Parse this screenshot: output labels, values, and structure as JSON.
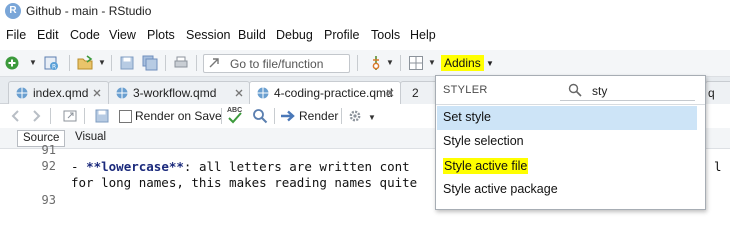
{
  "window": {
    "logo": "R",
    "title": "Github - main - RStudio"
  },
  "menu": [
    "File",
    "Edit",
    "Code",
    "View",
    "Plots",
    "Session",
    "Build",
    "Debug",
    "Profile",
    "Tools",
    "Help"
  ],
  "toolbar": {
    "goto_placeholder": "Go to file/function",
    "addins_label": "Addins"
  },
  "tabs": [
    {
      "label": "index.qmd",
      "active": false
    },
    {
      "label": "3-workflow.qmd",
      "active": false
    },
    {
      "label": "4-coding-practice.qmd",
      "active": true
    },
    {
      "label": "2",
      "active": false
    },
    {
      "label": "q",
      "active": false
    }
  ],
  "editor_toolbar": {
    "render_on_save_label": "Render on Save",
    "render_on_save_checked": false,
    "render_label": "Render",
    "spell_check_text": "ABC"
  },
  "mode_bar": {
    "source": "Source",
    "visual": "Visual"
  },
  "editor": {
    "lines": [
      {
        "number": "91",
        "segments": []
      },
      {
        "number": "92",
        "segments": [
          {
            "text": "- ",
            "style": "normal"
          },
          {
            "text": "**lowercase**",
            "style": "bold"
          },
          {
            "text": ": all letters are written cont",
            "style": "normal"
          }
        ]
      },
      {
        "number": "",
        "segments": [
          {
            "text": "for long names, this makes reading names quite",
            "style": "normal"
          }
        ]
      },
      {
        "number": "93",
        "segments": []
      }
    ],
    "overflow_right_char": "l"
  },
  "addins_popup": {
    "header": "STYLER",
    "search_value": "sty",
    "items": [
      {
        "label": "Set style",
        "selected": true,
        "highlighted": false
      },
      {
        "label": "Style selection",
        "selected": false,
        "highlighted": false
      },
      {
        "label": "Style active file",
        "selected": false,
        "highlighted": true
      },
      {
        "label": "Style active package",
        "selected": false,
        "highlighted": false
      }
    ]
  },
  "colors": {
    "highlight": "#ffff00",
    "selection": "#cde4f7",
    "toolbar_bg": "#f4f6f8"
  }
}
